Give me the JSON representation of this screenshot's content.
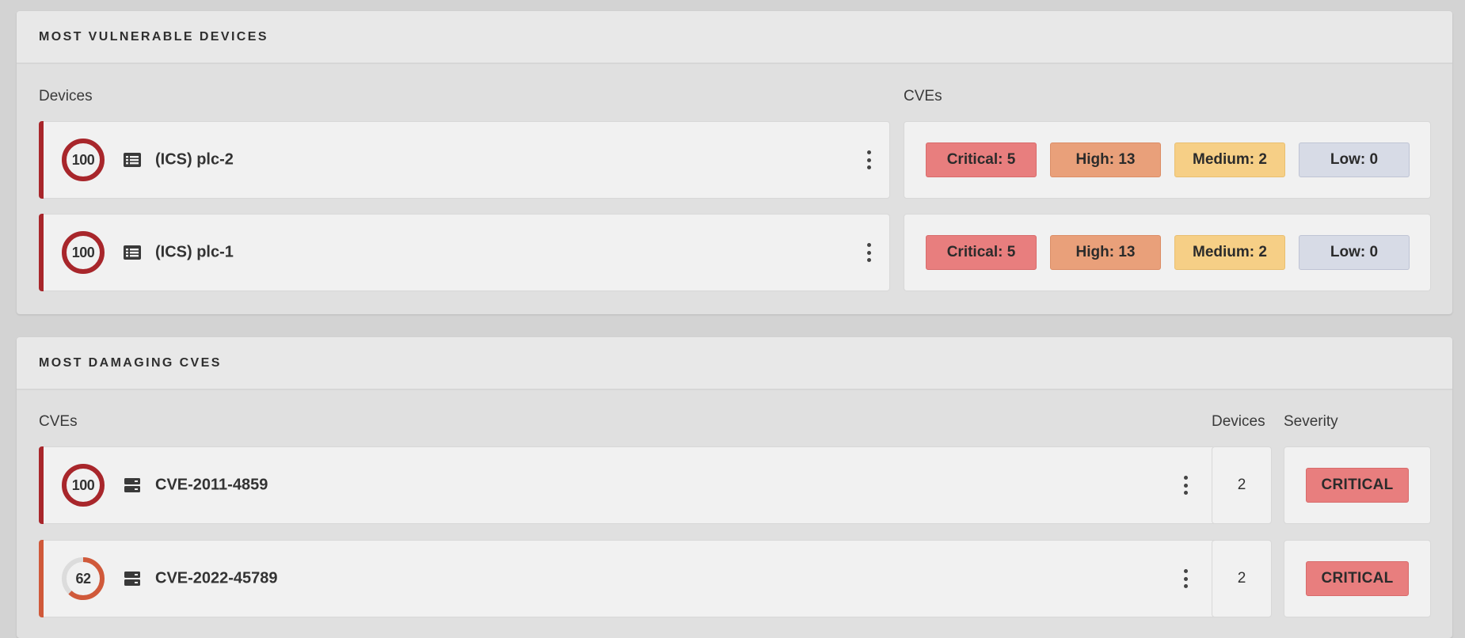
{
  "colors": {
    "critical": "#e87e7e",
    "high": "#e9a07a",
    "medium": "#f6cf86",
    "low": "#d7dbe6",
    "accent_critical": "#a8262b",
    "accent_high": "#d0593a"
  },
  "vulnerable_devices": {
    "title": "MOST VULNERABLE DEVICES",
    "devices_label": "Devices",
    "cves_label": "CVEs",
    "rows": [
      {
        "score": "100",
        "score_fraction": 1.0,
        "icon": "device-list-icon",
        "name": "(ICS) plc-2",
        "counts": {
          "critical": "Critical: 5",
          "high": "High: 13",
          "medium": "Medium: 2",
          "low": "Low: 0"
        }
      },
      {
        "score": "100",
        "score_fraction": 1.0,
        "icon": "device-list-icon",
        "name": "(ICS) plc-1",
        "counts": {
          "critical": "Critical: 5",
          "high": "High: 13",
          "medium": "Medium: 2",
          "low": "Low: 0"
        }
      }
    ]
  },
  "damaging_cves": {
    "title": "MOST DAMAGING CVES",
    "cves_label": "CVEs",
    "devices_label": "Devices",
    "severity_label": "Severity",
    "rows": [
      {
        "score": "100",
        "score_fraction": 1.0,
        "icon": "server-icon",
        "name": "CVE-2011-4859",
        "devices": "2",
        "severity": "CRITICAL"
      },
      {
        "score": "62",
        "score_fraction": 0.62,
        "icon": "server-icon",
        "name": "CVE-2022-45789",
        "devices": "2",
        "severity": "CRITICAL"
      }
    ]
  }
}
